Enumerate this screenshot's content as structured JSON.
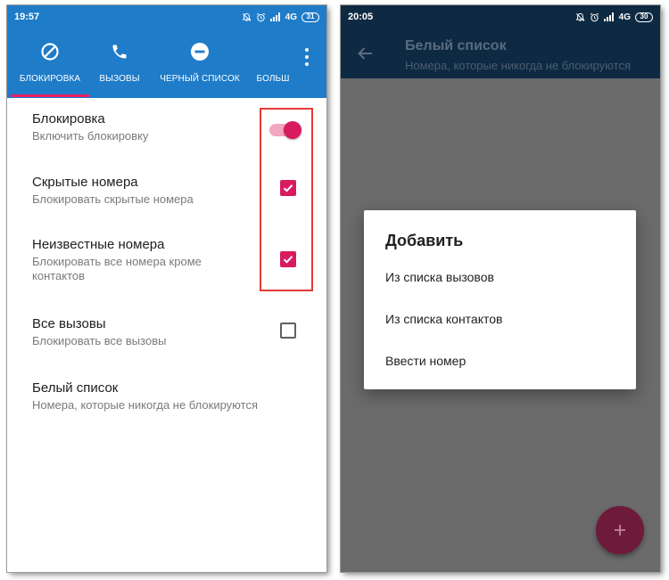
{
  "left": {
    "status": {
      "time": "19:57",
      "network": "4G",
      "battery": "31"
    },
    "tabs": [
      {
        "label": "БЛОКИРОВКА",
        "icon": "block-icon"
      },
      {
        "label": "ВЫЗОВЫ",
        "icon": "phone-icon"
      },
      {
        "label": "ЧЕРНЫЙ СПИСОК",
        "icon": "minus-circle-icon"
      },
      {
        "label": "БОЛЬШ",
        "icon": ""
      }
    ],
    "settings": [
      {
        "title": "Блокировка",
        "summary": "Включить блокировку",
        "control": "switch",
        "checked": true
      },
      {
        "title": "Скрытые номера",
        "summary": "Блокировать скрытые номера",
        "control": "checkbox",
        "checked": true
      },
      {
        "title": "Неизвестные номера",
        "summary_line1": "Блокировать все номера кроме",
        "summary_line2": "контактов",
        "control": "checkbox",
        "checked": true
      },
      {
        "title": "Все вызовы",
        "summary": "Блокировать все вызовы",
        "control": "checkbox",
        "checked": false
      },
      {
        "title": "Белый список",
        "summary": "Номера, которые никогда не блокируются"
      }
    ]
  },
  "right": {
    "status": {
      "time": "20:05",
      "network": "4G",
      "battery": "30"
    },
    "appbar": {
      "title": "Белый список",
      "subtitle": "Номера, которые никогда не блокируются"
    },
    "dialog": {
      "title": "Добавить",
      "items": [
        "Из списка вызовов",
        "Из списка контактов",
        "Ввести номер"
      ]
    },
    "fab_icon": "plus-icon"
  },
  "colors": {
    "primary": "#1f7cc8",
    "accent": "#d81b60",
    "dark_appbar": "#0e2a43",
    "highlight": "#e53935"
  }
}
